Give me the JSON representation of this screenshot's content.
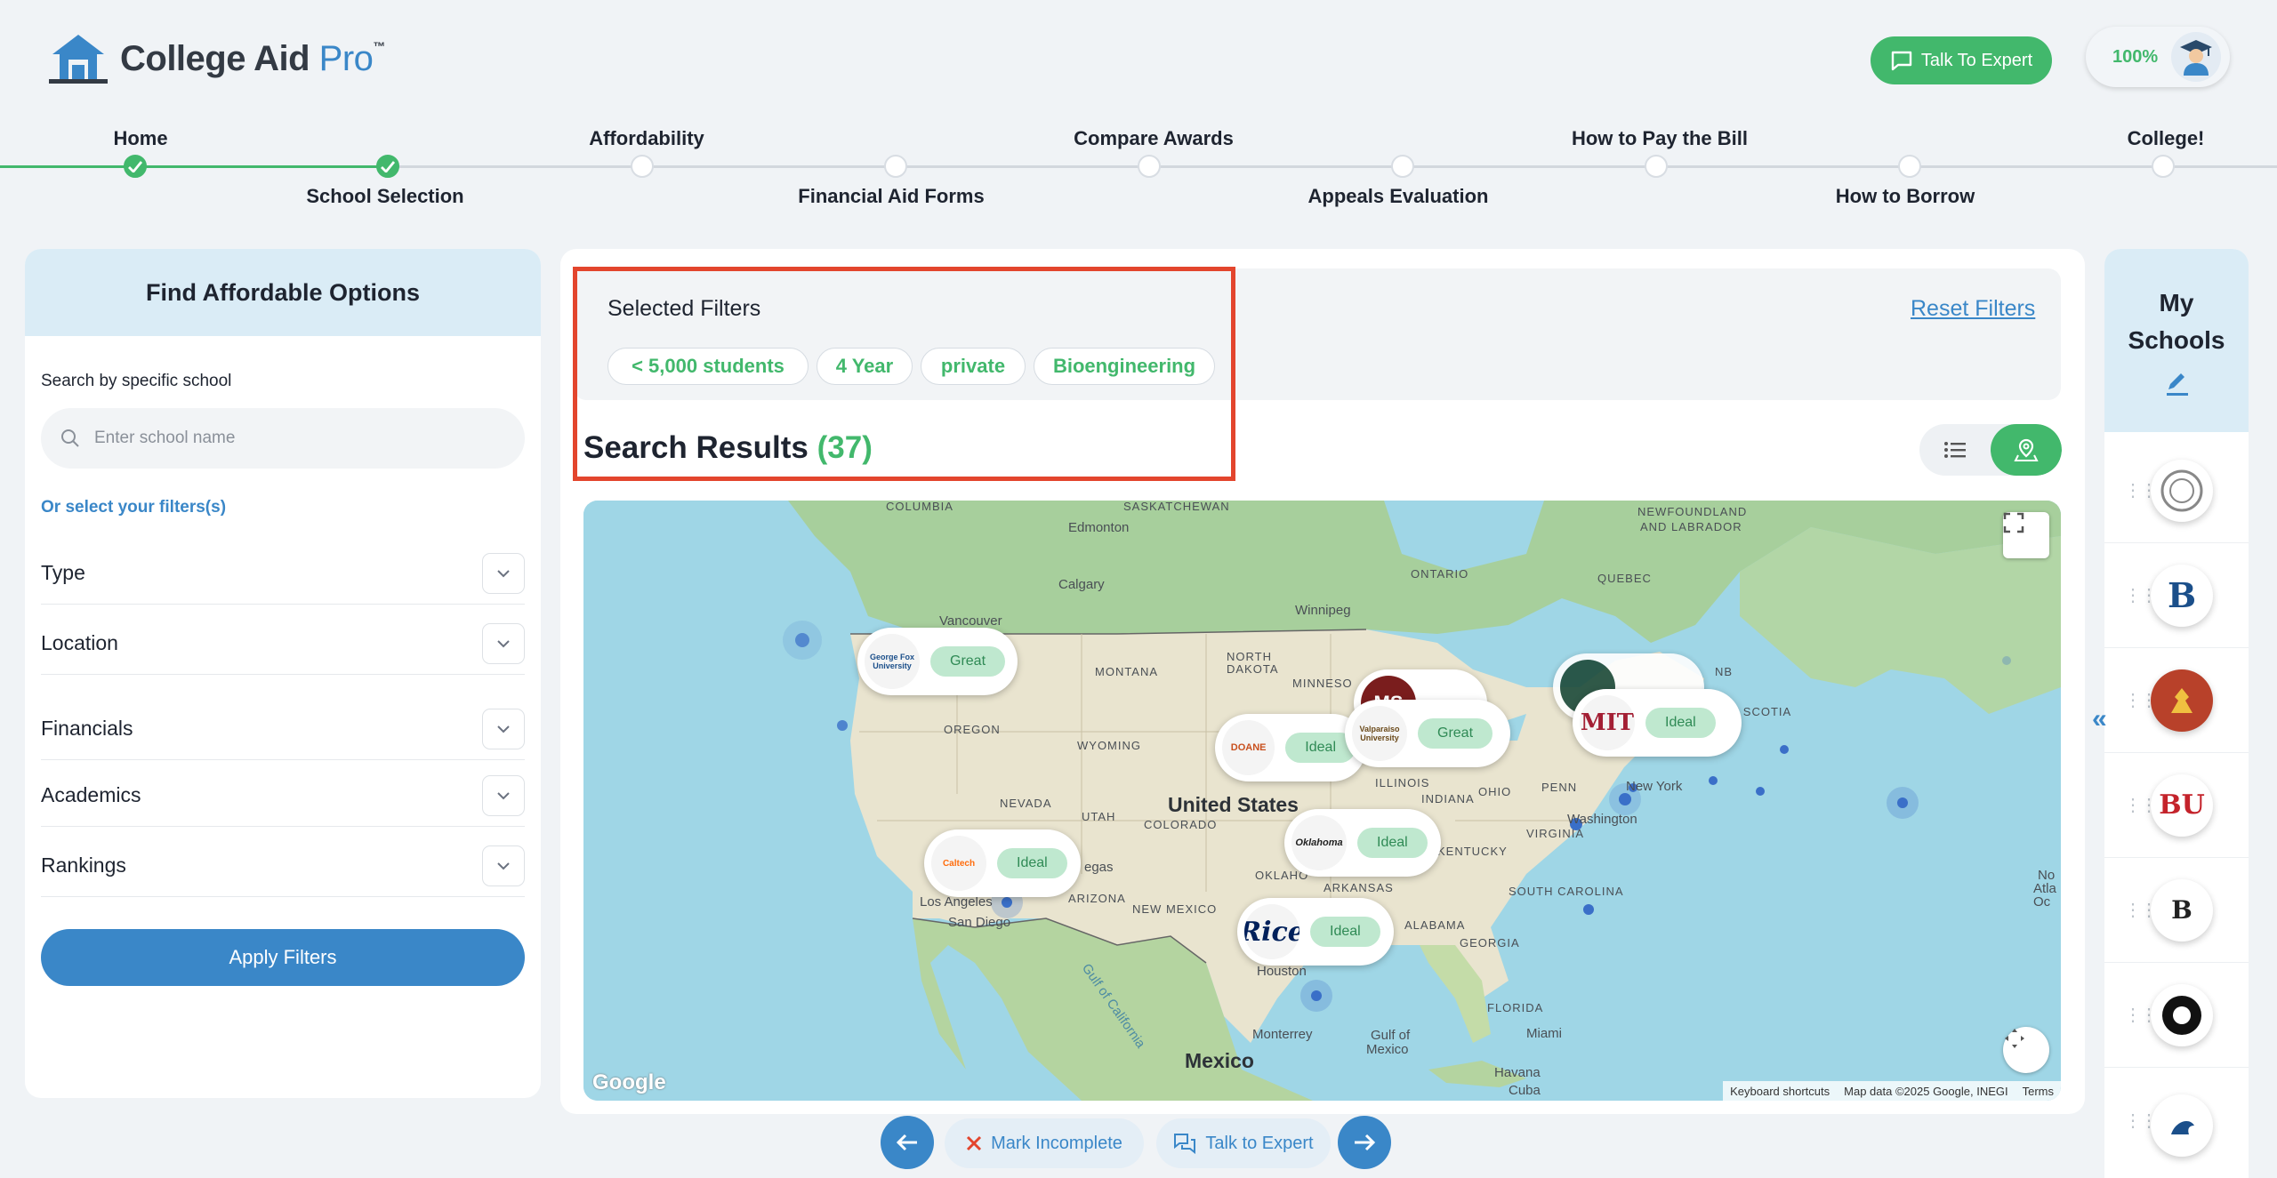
{
  "header": {
    "logo_main": "College Aid",
    "logo_accent": "Pro",
    "logo_tm": "™",
    "talk_expert_label": "Talk To Expert",
    "progress_percent": "100%"
  },
  "stepper": {
    "steps": [
      {
        "label": "Home",
        "status": "complete"
      },
      {
        "label": "School Selection",
        "status": "complete"
      },
      {
        "label": "Affordability",
        "status": "incomplete"
      },
      {
        "label": "Financial Aid Forms",
        "status": "incomplete"
      },
      {
        "label": "Compare Awards",
        "status": "incomplete"
      },
      {
        "label": "Appeals Evaluation",
        "status": "incomplete"
      },
      {
        "label": "How to Pay the Bill",
        "status": "incomplete"
      },
      {
        "label": "How to Borrow",
        "status": "incomplete"
      },
      {
        "label": "College!",
        "status": "incomplete"
      }
    ]
  },
  "left_panel": {
    "title": "Find Affordable Options",
    "search_label": "Search by specific school",
    "search_placeholder": "Enter school name",
    "search_value": "",
    "filters_link": "Or select your filters(s)",
    "filters": [
      "Type",
      "Location",
      "Financials",
      "Academics",
      "Rankings"
    ],
    "apply_label": "Apply Filters"
  },
  "main": {
    "selected_filters_title": "Selected Filters",
    "reset_label": "Reset Filters",
    "chips": [
      "< 5,000 students",
      "4 Year",
      "private",
      "Bioengineering"
    ],
    "results_label": "Search Results",
    "results_count": "(37)"
  },
  "map": {
    "labels": {
      "columbia": "COLUMBIA",
      "saskatchewan": "SASKATCHEWAN",
      "edmonton": "Edmonton",
      "newfoundland": "NEWFOUNDLAND",
      "labrador": "AND LABRADOR",
      "ontario": "ONTARIO",
      "calgary": "Calgary",
      "winnipeg": "Winnipeg",
      "quebec": "QUEBEC",
      "vancouver": "Vancouver",
      "montana": "MONTANA",
      "north": "NORTH",
      "dakota": "DAKOTA",
      "minneso": "MINNESO",
      "nb": "NB",
      "nova_scotia": "NOVA SCOTIA",
      "oregon": "OREGON",
      "wyoming": "WYOMING",
      "illinois": "ILLINOIS",
      "ohio": "OHIO",
      "penn": "PENN",
      "new_york": "New York",
      "nevada": "NEVADA",
      "utah": "UTAH",
      "colorado": "COLORADO",
      "united_states": "United States",
      "indiana": "INDIANA",
      "washington": "Washington",
      "virginia": "VIRGINIA",
      "kentucky": "KENTUCKY",
      "las_vegas": "egas",
      "los_angeles": "Los Angeles",
      "san_diego": "San Diego",
      "arizona": "ARIZONA",
      "new_mexico": "NEW MEXICO",
      "oklaho": "OKLAHO",
      "arkansas": "ARKANSAS",
      "south_carolina": "SOUTH CAROLINA",
      "alabama": "ALABAMA",
      "georgia": "GEORGIA",
      "houston": "Houston",
      "florida": "FLORIDA",
      "monterrey": "Monterrey",
      "gulf_mexico_1": "Gulf of",
      "gulf_mexico_2": "Mexico",
      "miami": "Miami",
      "mexico": "Mexico",
      "havana": "Havana",
      "cuba": "Cuba",
      "gulf_california": "Gulf of California",
      "north_atlantic_1": "No",
      "north_atlantic_2": "Atla",
      "north_atlantic_3": "Oc"
    },
    "markers": [
      {
        "logo_text": "George Fox University",
        "badge": "Great"
      },
      {
        "logo_text": "DOANE",
        "badge": "Ideal"
      },
      {
        "logo_text": "MS",
        "badge": ""
      },
      {
        "logo_text": "Valparaiso University",
        "badge": "Great"
      },
      {
        "logo_text": "MIT",
        "badge": "Ideal"
      },
      {
        "logo_text": "Caltech",
        "badge": "Ideal"
      },
      {
        "logo_text": "Oklahoma",
        "badge": "Ideal"
      },
      {
        "logo_text": "Rice",
        "badge": "Ideal"
      }
    ],
    "attribution": {
      "shortcuts": "Keyboard shortcuts",
      "data": "Map data ©2025 Google, INEGI",
      "terms": "Terms"
    },
    "google": "Google"
  },
  "right_panel": {
    "title": "My Schools",
    "schools": [
      {
        "abbr": "",
        "color": "#888888"
      },
      {
        "abbr": "B",
        "color": "#1b4f8a"
      },
      {
        "abbr": "",
        "color": "#b8412a"
      },
      {
        "abbr": "BU",
        "color": "#c4232b"
      },
      {
        "abbr": "B",
        "color": "#222222"
      },
      {
        "abbr": "",
        "color": "#111111"
      },
      {
        "abbr": "",
        "color": "#1b4f8a"
      }
    ]
  },
  "bottom_bar": {
    "mark_incomplete": "Mark Incomplete",
    "talk_expert": "Talk to Expert"
  },
  "colors": {
    "brand_green": "#42b86c",
    "brand_blue": "#3a87c8",
    "highlight_red": "#e3452d"
  }
}
